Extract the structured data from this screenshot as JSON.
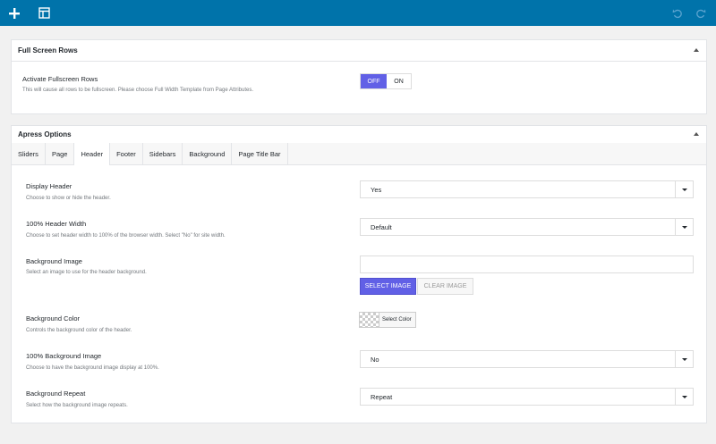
{
  "toolbar": {
    "add_icon": "plus-icon",
    "layout_icon": "layout-icon",
    "undo_icon": "undo-icon",
    "redo_icon": "redo-icon"
  },
  "fullscreen_panel": {
    "title": "Full Screen Rows",
    "option": {
      "label": "Activate Fullscreen Rows",
      "desc": "This will cause all rows to be fullscreen. Please choose Full Width Template from Page Attributes.",
      "off_label": "OFF",
      "on_label": "ON",
      "value": "OFF"
    }
  },
  "options_panel": {
    "title": "Apress Options",
    "tabs": [
      "Sliders",
      "Page",
      "Header",
      "Footer",
      "Sidebars",
      "Background",
      "Page Title Bar"
    ],
    "active_tab": "Header",
    "fields": {
      "display_header": {
        "label": "Display Header",
        "desc": "Choose to show or hide the header.",
        "value": "Yes"
      },
      "header_width": {
        "label": "100% Header Width",
        "desc": "Choose to set header width to 100% of the browser width. Select \"No\" for site width.",
        "value": "Default"
      },
      "bg_image": {
        "label": "Background Image",
        "desc": "Select an image to use for the header background.",
        "value": "",
        "select_label": "SELECT IMAGE",
        "clear_label": "CLEAR IMAGE"
      },
      "bg_color": {
        "label": "Background Color",
        "desc": "Controls the background color of the header.",
        "button_label": "Select Color"
      },
      "bg_full": {
        "label": "100% Background Image",
        "desc": "Choose to have the background image display at 100%.",
        "value": "No"
      },
      "bg_repeat": {
        "label": "Background Repeat",
        "desc": "Select how the background image repeats.",
        "value": "Repeat"
      }
    }
  },
  "colors": {
    "topbar": "#0073aa",
    "accent": "#6160e6"
  }
}
